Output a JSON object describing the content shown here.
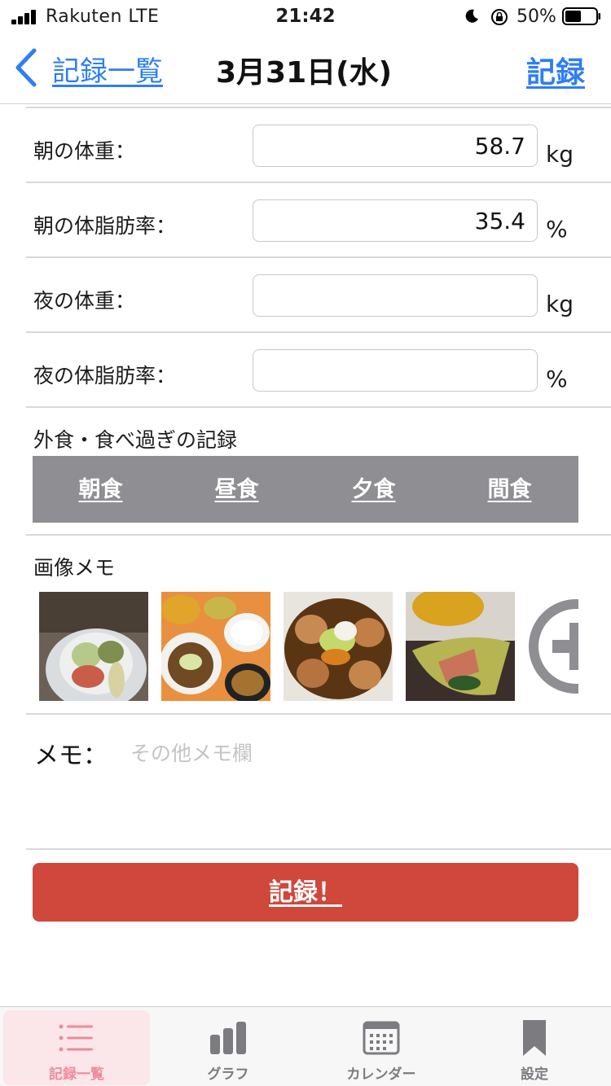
{
  "status_bar": {
    "carrier": "Rakuten  LTE",
    "time": "21:42",
    "battery": "50%"
  },
  "nav": {
    "back_label": "記録一覧",
    "title": "3月31日(水)",
    "record_label": "記録"
  },
  "form": {
    "rows": [
      {
        "label": "朝の体重：",
        "value": "58.7",
        "unit": "kg"
      },
      {
        "label": "朝の体脂肪率：",
        "value": "35.4",
        "unit": "%"
      },
      {
        "label": "夜の体重：",
        "value": "",
        "unit": "kg"
      },
      {
        "label": "夜の体脂肪率：",
        "value": "",
        "unit": "%"
      }
    ]
  },
  "eating_out": {
    "title": "外食・食べ過ぎの記録",
    "meals": [
      "朝食",
      "昼食",
      "夕食",
      "間食"
    ]
  },
  "image_memo": {
    "title": "画像メモ"
  },
  "memo": {
    "label": "メモ：",
    "placeholder": "その他メモ欄",
    "value": ""
  },
  "submit_label": "記録！",
  "tab_bar": {
    "tabs": [
      {
        "label": "記録一覧",
        "icon": "list-icon",
        "active": true
      },
      {
        "label": "グラフ",
        "icon": "bar-chart-icon",
        "active": false
      },
      {
        "label": "カレンダー",
        "icon": "calendar-icon",
        "active": false
      },
      {
        "label": "設定",
        "icon": "bookmark-icon",
        "active": false
      }
    ]
  },
  "colors": {
    "link_blue": "#2f7ef4",
    "meal_bar_gray": "#8e8e93",
    "submit_red": "#d0473b",
    "active_tab_pink": "#ee8b9b"
  }
}
